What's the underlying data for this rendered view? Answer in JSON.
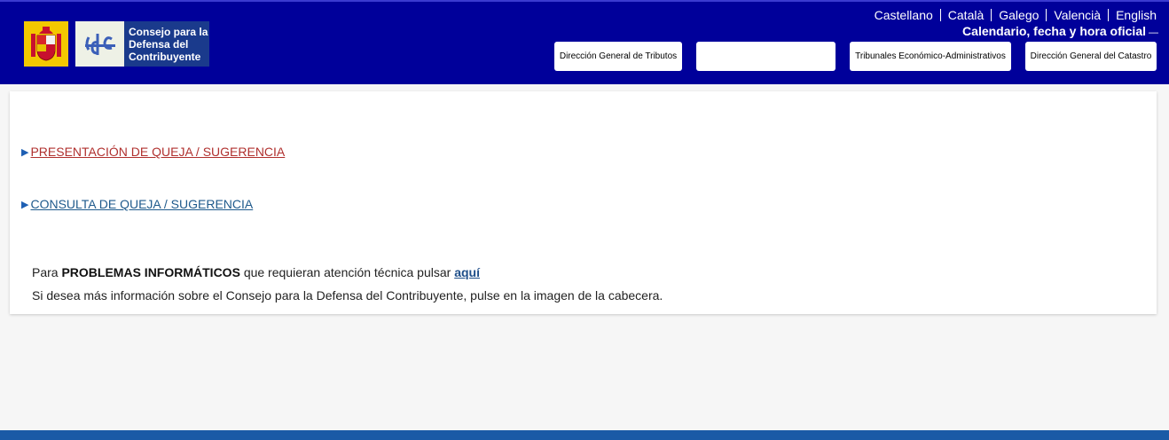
{
  "header": {
    "logo_text": "Consejo para la Defensa del Contribuyente",
    "logo_lines": [
      "Consejo para la",
      "Defensa del",
      "Contribuyente"
    ],
    "languages": [
      "Castellano",
      "Català",
      "Galego",
      "Valencià",
      "English"
    ],
    "calendar_label": "Calendario, fecha y hora oficial",
    "nav_buttons": [
      "Dirección General de Tributos",
      "",
      "Tribunales Económico-Administrativos",
      "Dirección General del Catastro"
    ]
  },
  "main": {
    "link_present": "PRESENTACIÓN DE QUEJA / SUGERENCIA",
    "link_consult": "CONSULTA DE QUEJA / SUGERENCIA",
    "problems_prefix": "Para",
    "problems_bold": "PROBLEMAS INFORMÁTICOS",
    "problems_suffix": "que requieran atención técnica pulsar",
    "problems_link": "aquí",
    "more_info": "Si desea más información sobre el Consejo para la Defensa del Contribuyente, pulse en la imagen de la cabecera."
  },
  "colors": {
    "header_bg": "#00009a",
    "link_red": "#b0302e",
    "link_blue": "#1f5a8c",
    "footer": "#1a5aa6"
  }
}
